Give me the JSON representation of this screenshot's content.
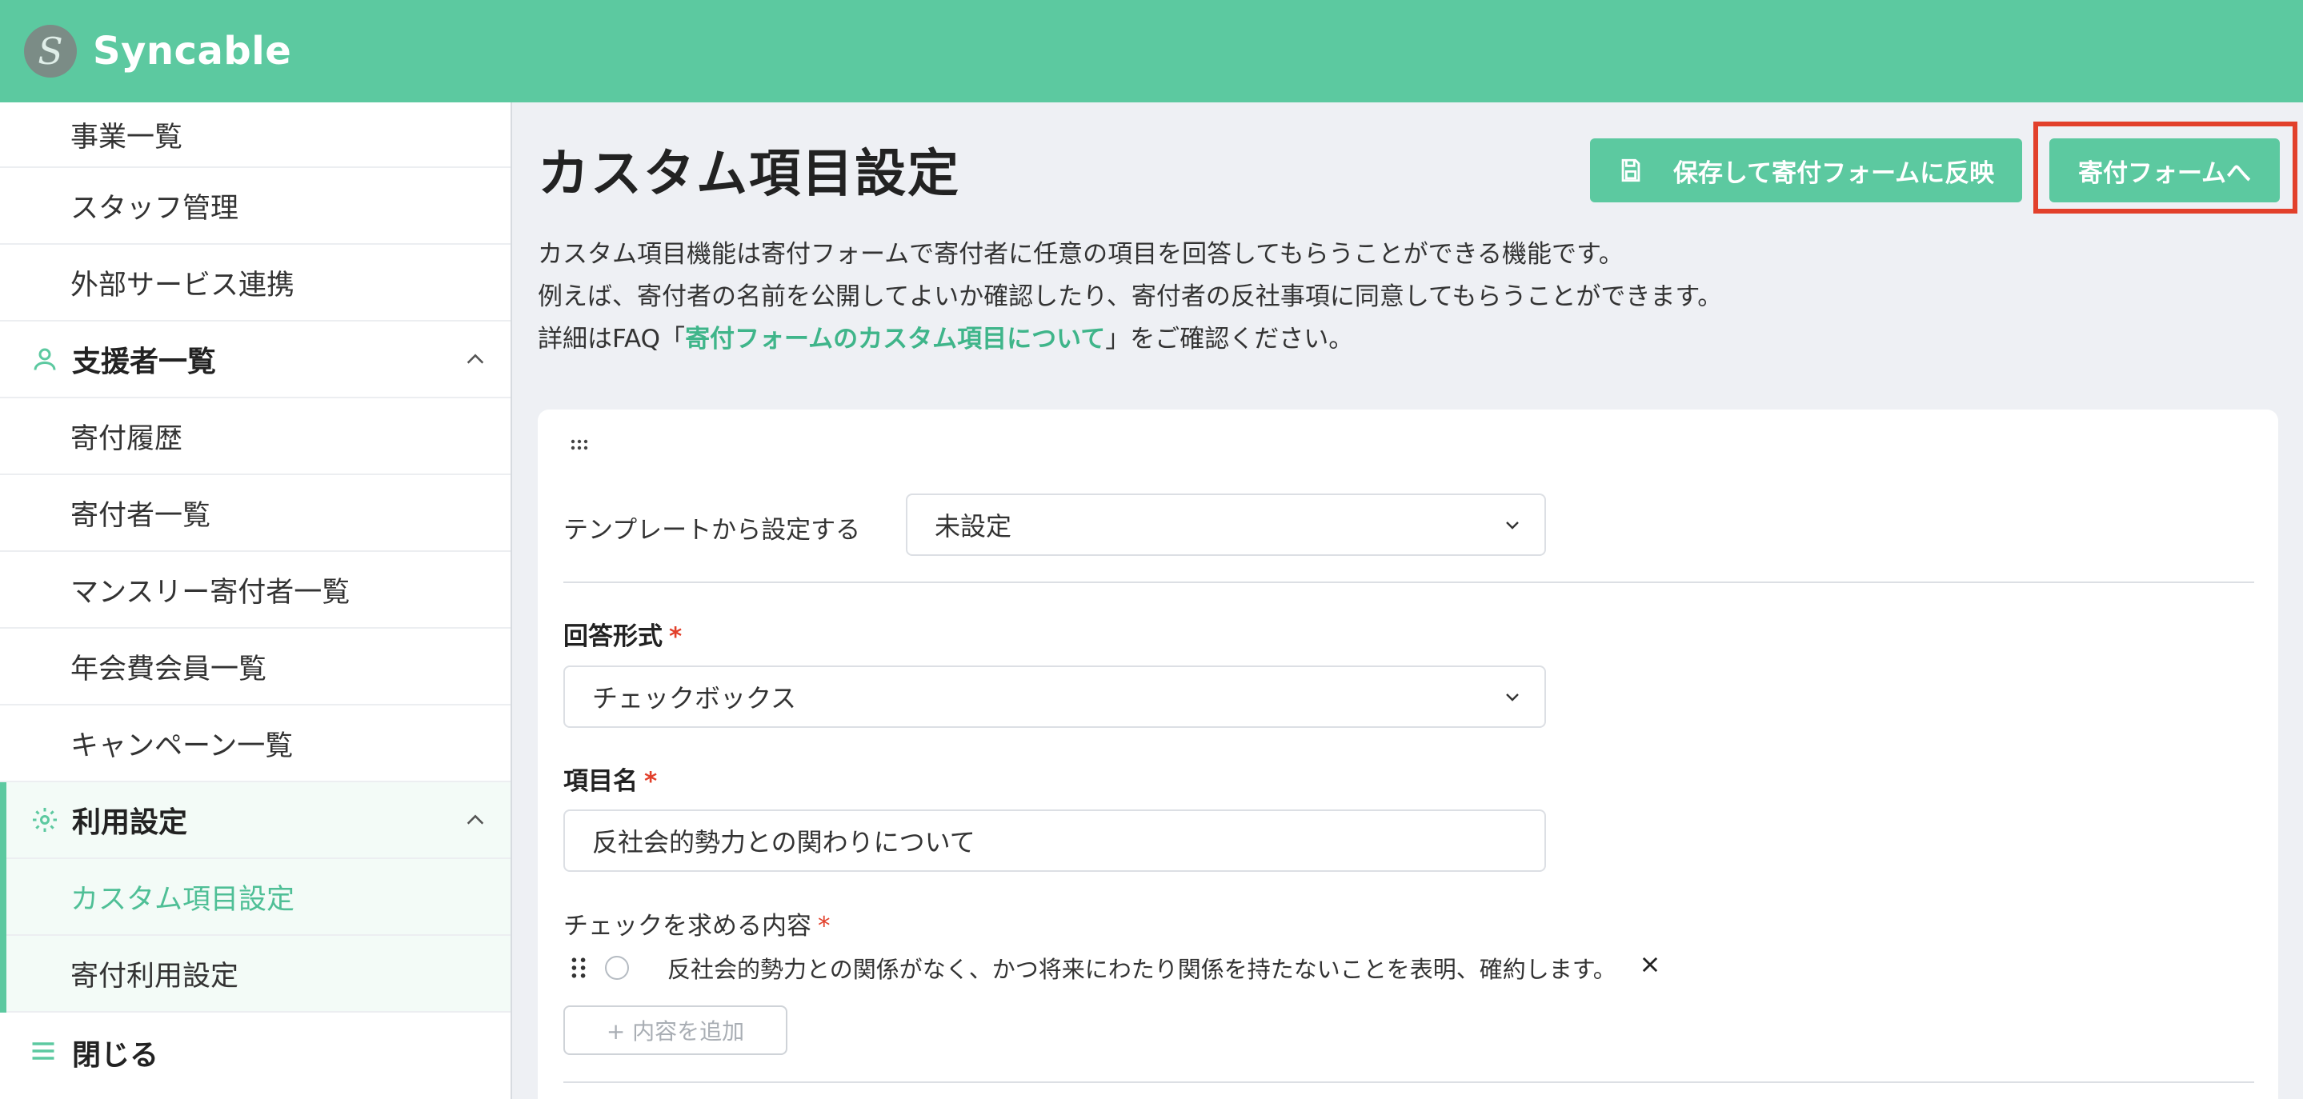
{
  "header": {
    "logo_letter": "S",
    "brand": "Syncable",
    "accent": "#5cc9a0"
  },
  "sidebar": {
    "items_top": [
      "事業一覧",
      "スタッフ管理",
      "外部サービス連携"
    ],
    "section_supporters": {
      "label": "支援者一覧",
      "icon": "person-icon",
      "items": [
        "寄付履歴",
        "寄付者一覧",
        "マンスリー寄付者一覧",
        "年会費会員一覧",
        "キャンペーン一覧"
      ]
    },
    "section_settings": {
      "label": "利用設定",
      "icon": "gear-icon",
      "items": [
        "カスタム項目設定",
        "寄付利用設定"
      ],
      "active": "カスタム項目設定"
    },
    "close_label": "閉じる"
  },
  "main": {
    "title": "カスタム項目設定",
    "save_button": "保存して寄付フォームに反映",
    "form_button": "寄付フォームへ",
    "desc_line1": "カスタム項目機能は寄付フォームで寄付者に任意の項目を回答してもらうことができる機能です。",
    "desc_line2": "例えば、寄付者の名前を公開してよいか確認したり、寄付者の反社事項に同意してもらうことができます。",
    "desc_line3_prefix": "詳細はFAQ「",
    "desc_line3_link": "寄付フォームのカスタム項目について",
    "desc_line3_suffix": "」をご確認ください。",
    "template_label": "テンプレートから設定する",
    "template_value": "未設定",
    "answer_type_label": "回答形式",
    "answer_type_value": "チェックボックス",
    "item_name_label": "項目名",
    "item_name_value": "反社会的勢力との関わりについて",
    "check_content_label": "チェックを求める内容",
    "required_mark": "*",
    "options": [
      "反社会的勢力との関係がなく、かつ将来にわたり関係を持たないことを表明、確約します。"
    ],
    "add_content_button": "+ 内容を追加"
  }
}
